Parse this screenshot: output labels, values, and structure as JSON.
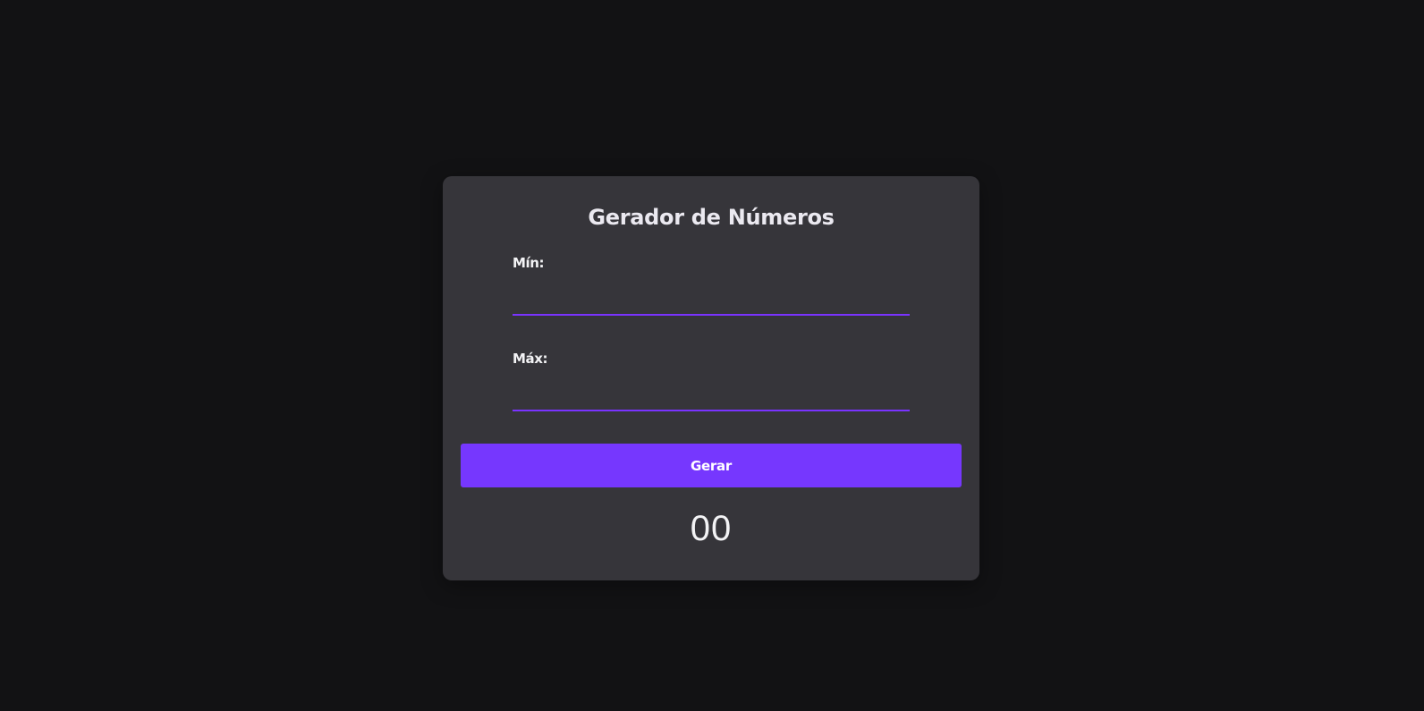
{
  "generator": {
    "title": "Gerador de Números",
    "min_label": "Mín:",
    "min_value": "",
    "max_label": "Máx:",
    "max_value": "",
    "button_label": "Gerar",
    "result": "00"
  },
  "colors": {
    "background": "#121214",
    "card": "#36353a",
    "accent": "#7637fe",
    "text": "#e1e1e6"
  }
}
